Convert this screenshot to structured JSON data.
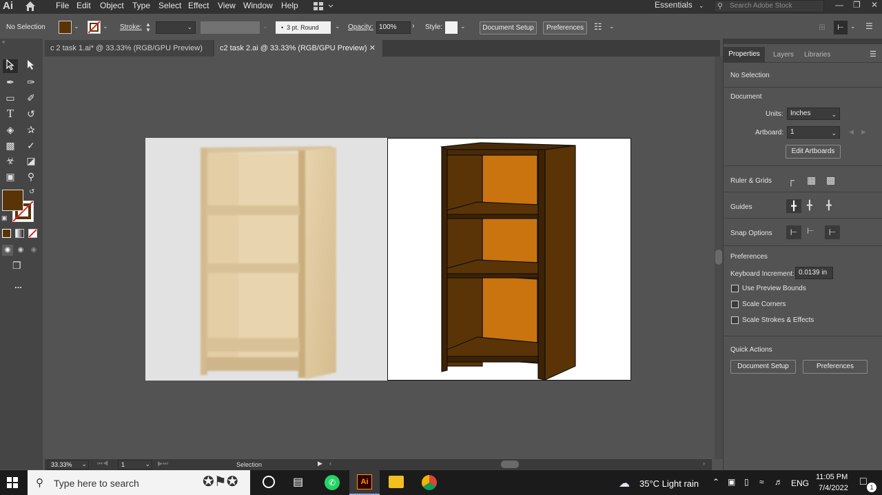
{
  "app": {
    "logo": "Ai"
  },
  "menu": {
    "items": [
      "File",
      "Edit",
      "Object",
      "Type",
      "Select",
      "Effect",
      "View",
      "Window",
      "Help"
    ]
  },
  "workspace": {
    "label": "Essentials",
    "search_placeholder": "Search Adobe Stock"
  },
  "control": {
    "selection_label": "No Selection",
    "stroke_label": "Stroke:",
    "brush_label": "3 pt. Round",
    "opacity_label": "Opacity:",
    "opacity_value": "100%",
    "style_label": "Style:",
    "doc_setup_label": "Document Setup",
    "preferences_label": "Preferences",
    "fill_color": "#5a3406"
  },
  "tabs": [
    {
      "label": "c 2 task 1.ai* @ 33.33% (RGB/GPU Preview)"
    },
    {
      "label": "c2 task 2.ai @ 33.33% (RGB/GPU Preview)"
    }
  ],
  "tools": {
    "fill_color": "#5a3406",
    "more_label": "..."
  },
  "panel": {
    "tabs": [
      "Properties",
      "Layers",
      "Libraries"
    ],
    "no_selection": "No Selection",
    "document_header": "Document",
    "units_label": "Units:",
    "units_value": "Inches",
    "artboard_label": "Artboard:",
    "artboard_value": "1",
    "edit_artboards": "Edit Artboards",
    "ruler_grids": "Ruler & Grids",
    "guides": "Guides",
    "snap_options": "Snap Options",
    "preferences_header": "Preferences",
    "keyboard_increment_label": "Keyboard Increment:",
    "keyboard_increment_value": "0.0139 in",
    "use_preview_bounds": "Use Preview Bounds",
    "scale_corners": "Scale Corners",
    "scale_strokes": "Scale Strokes & Effects",
    "quick_actions": "Quick Actions",
    "doc_setup_btn": "Document Setup",
    "preferences_btn": "Preferences"
  },
  "status": {
    "zoom": "33.33%",
    "artboard": "1",
    "tool": "Selection"
  },
  "taskbar": {
    "search_placeholder": "Type here to search",
    "weather": "35°C  Light rain",
    "lang": "ENG",
    "time": "11:05 PM",
    "date": "7/4/2022",
    "notif_count": "1"
  }
}
